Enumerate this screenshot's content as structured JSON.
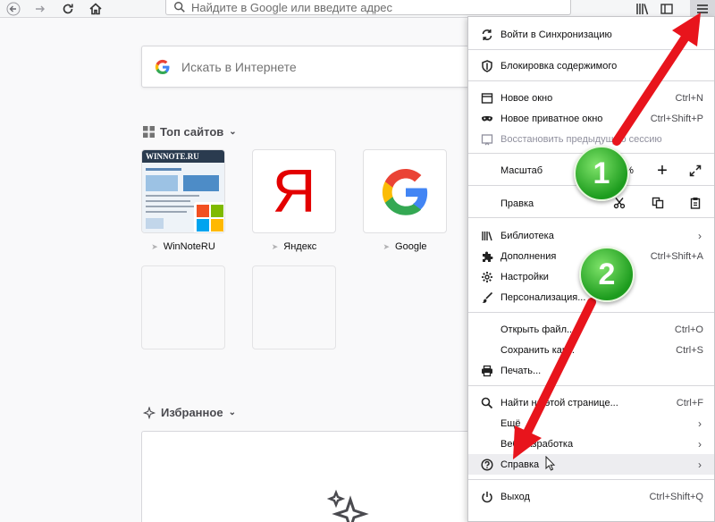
{
  "toolbar": {
    "url_placeholder": "Найдите в Google или введите адрес"
  },
  "newtab": {
    "search_placeholder": "Искать в Интернете",
    "top_sites_title": "Топ сайтов",
    "favorites_title": "Избранное",
    "tiles": [
      {
        "label": "WinNoteRU",
        "logo_text": "WINNOTE.RU"
      },
      {
        "label": "Яндекс",
        "logo_text": "Я"
      },
      {
        "label": "Google"
      }
    ]
  },
  "menu": {
    "sync": "Войти в Синхронизацию",
    "content_blocking": "Блокировка содержимого",
    "new_window": {
      "label": "Новое окно",
      "shortcut": "Ctrl+N"
    },
    "private_window": {
      "label": "Новое приватное окно",
      "shortcut": "Ctrl+Shift+P"
    },
    "restore_session": "Восстановить предыдущую сессию",
    "zoom": {
      "label": "Масштаб",
      "value": "%",
      "plus": "+"
    },
    "edit": "Правка",
    "library": "Библиотека",
    "addons": {
      "label": "Дополнения",
      "shortcut": "Ctrl+Shift+A"
    },
    "options": "Настройки",
    "customize": "Персонализация...",
    "open_file": {
      "label": "Открыть файл...",
      "shortcut": "Ctrl+O"
    },
    "save_as": {
      "label": "Сохранить как...",
      "shortcut": "Ctrl+S"
    },
    "print": "Печать...",
    "find": {
      "label": "Найти на этой странице...",
      "shortcut": "Ctrl+F"
    },
    "more": "Ещё",
    "web_dev": "Веб-разработка",
    "help": "Справка",
    "quit": {
      "label": "Выход",
      "shortcut": "Ctrl+Shift+Q"
    }
  },
  "annotations": {
    "badge1": "1",
    "badge2": "2",
    "arrow_color": "#e8141c",
    "badge_color": "#2fb52f"
  }
}
